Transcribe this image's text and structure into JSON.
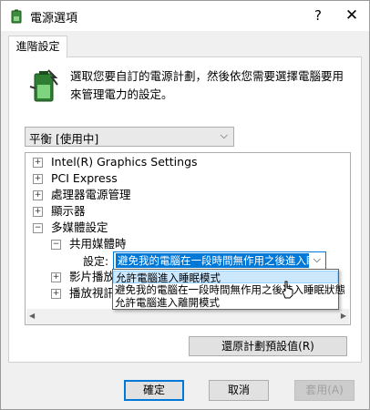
{
  "window": {
    "title": "電源選項",
    "help_glyph": "?",
    "close_glyph": "✕"
  },
  "tab": {
    "label": "進階設定"
  },
  "description": "選取您要自訂的電源計劃，然後依您需要選擇電腦要用來管理電力的設定。",
  "plan_select": {
    "value": "平衡 [使用中]"
  },
  "tree": {
    "items": [
      {
        "label": "Intel(R) Graphics Settings",
        "state": "+"
      },
      {
        "label": "PCI Express",
        "state": "+"
      },
      {
        "label": "處理器電源管理",
        "state": "+"
      },
      {
        "label": "顯示器",
        "state": "+"
      },
      {
        "label": "多媒體設定",
        "state": "−"
      },
      {
        "label": "共用媒體時",
        "state": "−"
      },
      {
        "label": "影片播放",
        "state": "+"
      },
      {
        "label": "播放視訊",
        "state": "+"
      }
    ],
    "setting_label": "設定:",
    "setting_value": "避免我的電腦在一段時間無作用之後進入睡眠"
  },
  "dropdown": {
    "options": [
      "允許電腦進入睡眠模式",
      "避免我的電腦在一段時間無作用之後進入睡眠狀態",
      "允許電腦進入離開模式"
    ],
    "selected_index": 0
  },
  "buttons": {
    "restore": "還原計劃預設值(R)",
    "ok": "確定",
    "cancel": "取消",
    "apply": "套用(A)"
  },
  "colors": {
    "accent": "#0078d7",
    "highlight": "#cce8ff"
  }
}
